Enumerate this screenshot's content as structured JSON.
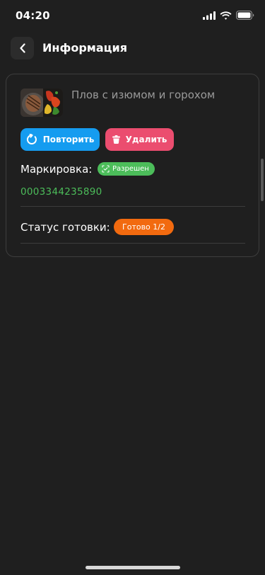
{
  "status_bar": {
    "time": "04:20"
  },
  "header": {
    "title": "Информация"
  },
  "card": {
    "dish_name": "Плов с изюмом и горохом",
    "repeat_label": "Повторить",
    "delete_label": "Удалить",
    "marking_label": "Маркировка:",
    "marking_badge": "Разрешен",
    "marking_code": "0003344235890",
    "status_label": "Статус готовки:",
    "status_badge": "Готово 1/2"
  },
  "colors": {
    "background": "#1f1f1f",
    "repeat_button": "#159cf0",
    "delete_button": "#eb4d6f",
    "allowed_badge": "#4cbd5a",
    "ready_badge": "#f26a0f"
  },
  "icons": {
    "back": "chevron-left-icon",
    "repeat": "refresh-icon",
    "delete": "trash-icon",
    "marking": "scan-check-icon"
  }
}
